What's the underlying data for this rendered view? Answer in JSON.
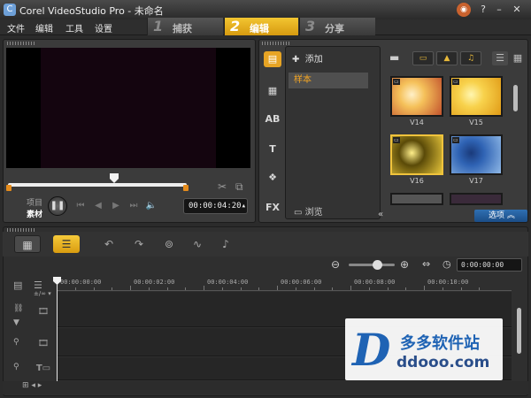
{
  "window": {
    "title": "Corel VideoStudio Pro - 未命名"
  },
  "menu": [
    "文件",
    "编辑",
    "工具",
    "设置"
  ],
  "steps": [
    {
      "number": "1",
      "label": "捕获"
    },
    {
      "number": "2",
      "label": "编辑"
    },
    {
      "number": "3",
      "label": "分享"
    }
  ],
  "player": {
    "mode_project": "项目",
    "mode_clip": "素材",
    "timecode": "00:00:04:20"
  },
  "library": {
    "categories": [
      "",
      "",
      "AB",
      "T",
      "",
      "FX"
    ],
    "add_label": "添加",
    "folder_item": "样本",
    "browse_label": "浏览",
    "thumbnails": [
      {
        "label": "V14",
        "colors": [
          "#f5c15a",
          "#c2522d",
          "#fff0c8"
        ]
      },
      {
        "label": "V15",
        "colors": [
          "#f8d24c",
          "#e09a16",
          "#fff6b0"
        ]
      },
      {
        "label": "V16",
        "colors": [
          "#5a4a08",
          "#e5c43a",
          "#ffef8a"
        ]
      },
      {
        "label": "V17",
        "colors": [
          "#2f63b4",
          "#8fb8e6",
          "#1a3a7a"
        ]
      }
    ],
    "options_label": "选项"
  },
  "timeline": {
    "timecode": "0:00:00:00",
    "ruler": [
      "00:00:00:00",
      "00:00:02:00",
      "00:00:04:00",
      "00:00:06:00",
      "00:00:08:00",
      "00:00:10:00"
    ]
  },
  "watermark": {
    "title": "多多软件站",
    "url": "ddooo.com",
    "logo": "D"
  },
  "colors": {
    "accent": "#f0b429",
    "options_blue": "#2566a8"
  }
}
